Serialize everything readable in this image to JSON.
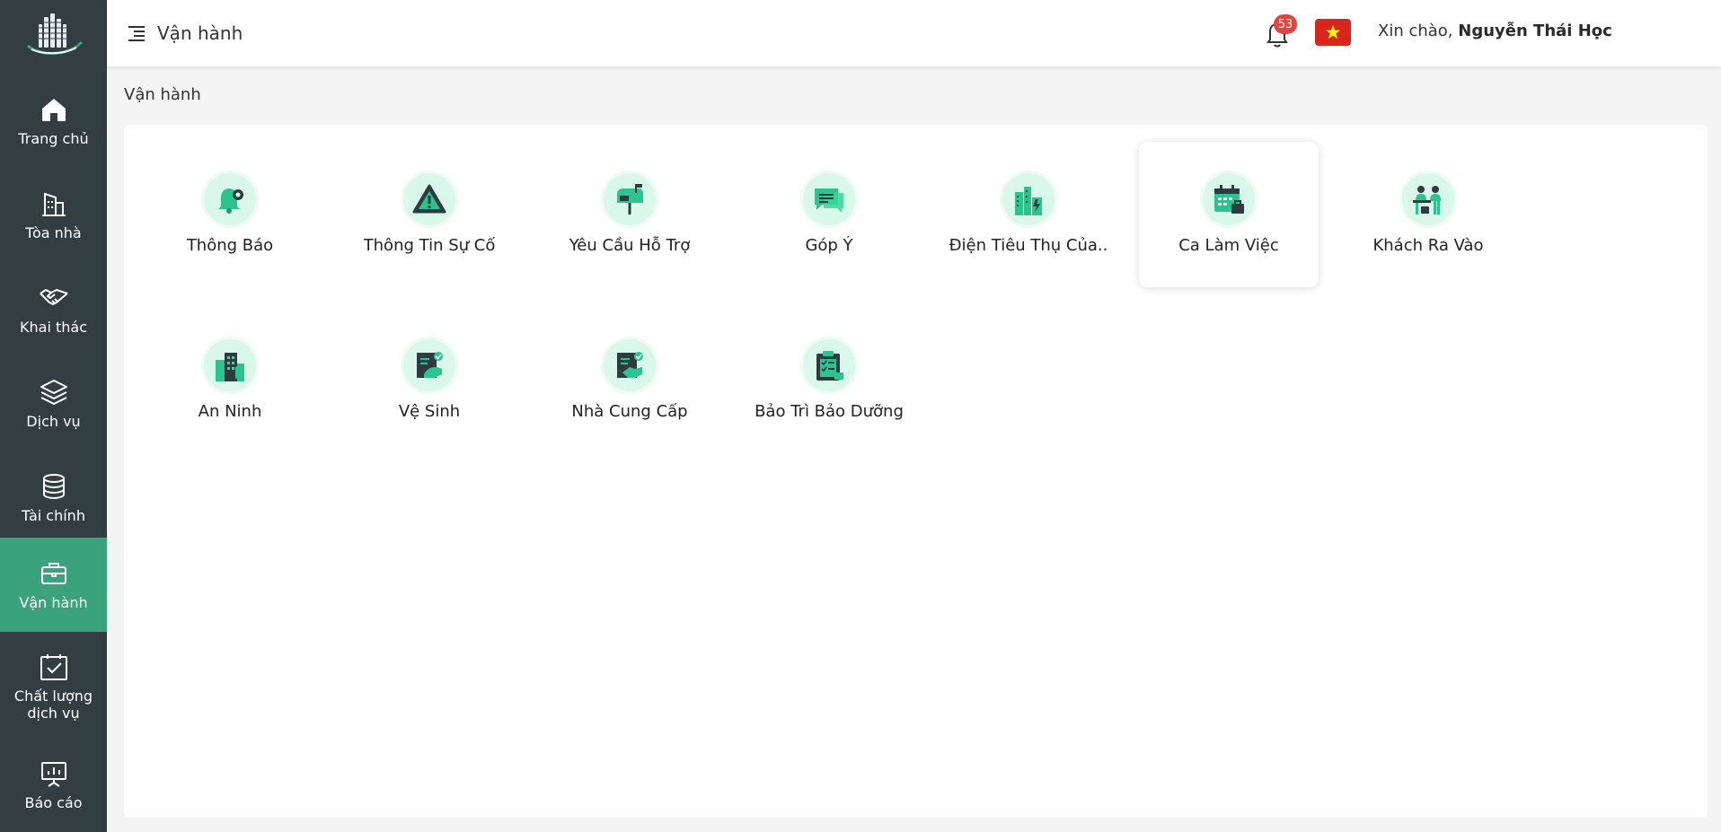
{
  "app": {
    "brand_colors": {
      "sidebar": "#323e42",
      "active": "#3aa27c",
      "accent_icon": "#2bc48f",
      "badge": "#e84141"
    }
  },
  "sidebar": {
    "items": [
      {
        "label": "Trang chủ",
        "icon": "home-icon",
        "active": false
      },
      {
        "label": "Tòa nhà",
        "icon": "building-icon",
        "active": false
      },
      {
        "label": "Khai thác",
        "icon": "handshake-icon",
        "active": false
      },
      {
        "label": "Dịch vụ",
        "icon": "layers-icon",
        "active": false
      },
      {
        "label": "Tài chính",
        "icon": "database-icon",
        "active": false
      },
      {
        "label": "Vận hành",
        "icon": "briefcase-icon",
        "active": true
      },
      {
        "label": "Chất lượng\ndịch vụ",
        "icon": "calendar-check-icon",
        "active": false
      },
      {
        "label": "Báo cáo",
        "icon": "presentation-chart-icon",
        "active": false
      }
    ]
  },
  "header": {
    "title": "Vận hành",
    "notification_count": "53",
    "language_flag": "vietnam-flag-icon",
    "greeting_prefix": "Xin chào, ",
    "user_name": "Nguyễn Thái Học"
  },
  "breadcrumb": {
    "current": "Vận hành"
  },
  "modules": [
    {
      "label": "Thông Báo",
      "icon": "bell-gear-icon"
    },
    {
      "label": "Thông Tin Sự Cố",
      "icon": "warning-triangle-icon"
    },
    {
      "label": "Yêu Cầu Hỗ Trợ",
      "icon": "mailbox-icon"
    },
    {
      "label": "Góp Ý",
      "icon": "chat-bubble-icon"
    },
    {
      "label": "Điện Tiêu Thụ Của..",
      "icon": "power-plant-icon"
    },
    {
      "label": "Ca Làm Việc",
      "icon": "calendar-briefcase-icon"
    },
    {
      "label": "Khách Ra Vào",
      "icon": "reception-visitors-icon"
    },
    {
      "label": "An Ninh",
      "icon": "security-building-icon"
    },
    {
      "label": "Vệ Sinh",
      "icon": "cleaning-document-icon"
    },
    {
      "label": "Nhà Cung Cấp",
      "icon": "supplier-handshake-icon"
    },
    {
      "label": "Bảo Trì Bảo Dưỡng",
      "icon": "maintenance-clipboard-icon"
    }
  ]
}
